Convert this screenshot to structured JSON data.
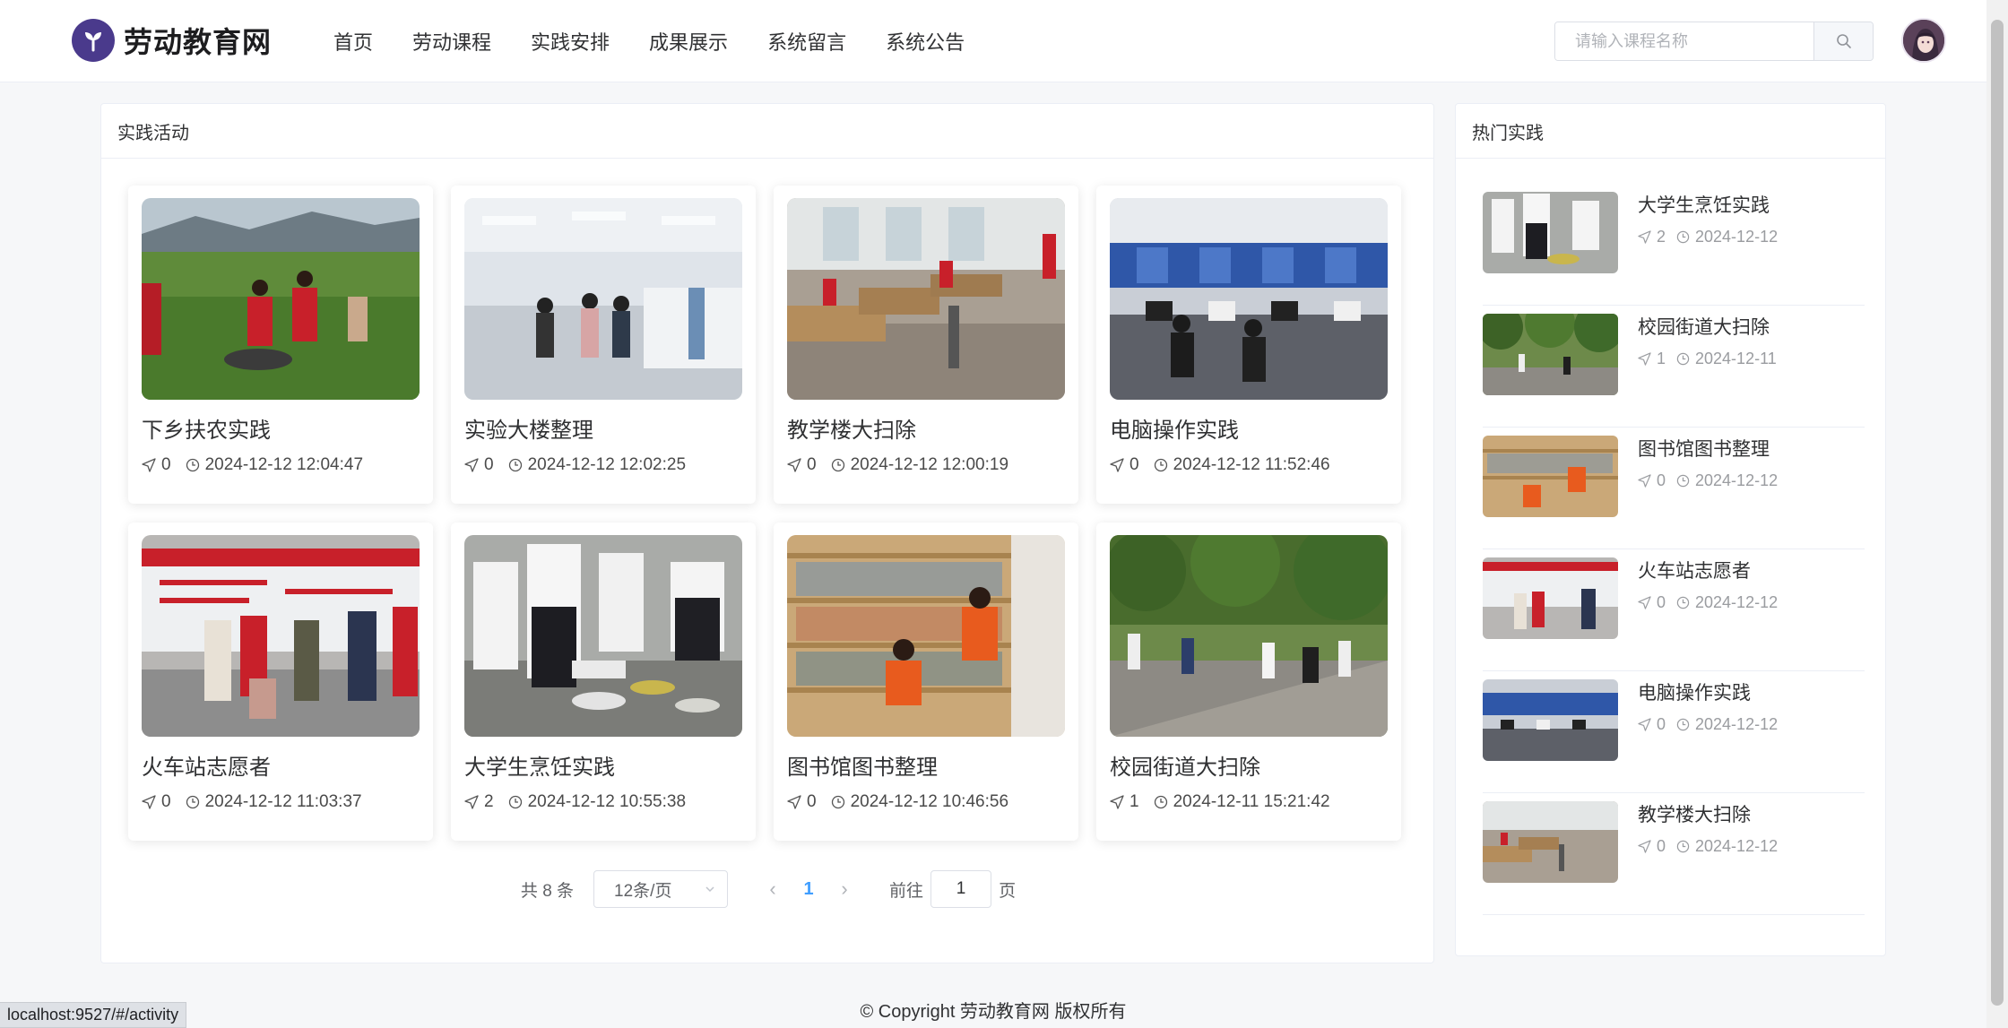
{
  "site": {
    "name": "劳动教育网",
    "brand_color": "#4a3a8c"
  },
  "nav": {
    "items": [
      "首页",
      "劳动课程",
      "实践安排",
      "成果展示",
      "系统留言",
      "系统公告"
    ]
  },
  "search": {
    "placeholder": "请输入课程名称",
    "icon": "search-icon"
  },
  "main": {
    "title": "实践活动",
    "cards": [
      {
        "title": "下乡扶农实践",
        "views": "0",
        "time": "2024-12-12 12:04:47"
      },
      {
        "title": "实验大楼整理",
        "views": "0",
        "time": "2024-12-12 12:02:25"
      },
      {
        "title": "教学楼大扫除",
        "views": "0",
        "time": "2024-12-12 12:00:19"
      },
      {
        "title": "电脑操作实践",
        "views": "0",
        "time": "2024-12-12 11:52:46"
      },
      {
        "title": "火车站志愿者",
        "views": "0",
        "time": "2024-12-12 11:03:37"
      },
      {
        "title": "大学生烹饪实践",
        "views": "2",
        "time": "2024-12-12 10:55:38"
      },
      {
        "title": "图书馆图书整理",
        "views": "0",
        "time": "2024-12-12 10:46:56"
      },
      {
        "title": "校园街道大扫除",
        "views": "1",
        "time": "2024-12-11 15:21:42"
      }
    ]
  },
  "pagination": {
    "total": "共 8 条",
    "page_size": "12条/页",
    "current": "1",
    "goto_prefix": "前往",
    "goto_value": "1",
    "goto_suffix": "页",
    "active_color": "#409eff"
  },
  "hot": {
    "title": "热门实践",
    "items": [
      {
        "title": "大学生烹饪实践",
        "views": "2",
        "date": "2024-12-12"
      },
      {
        "title": "校园街道大扫除",
        "views": "1",
        "date": "2024-12-11"
      },
      {
        "title": "图书馆图书整理",
        "views": "0",
        "date": "2024-12-12"
      },
      {
        "title": "火车站志愿者",
        "views": "0",
        "date": "2024-12-12"
      },
      {
        "title": "电脑操作实践",
        "views": "0",
        "date": "2024-12-12"
      },
      {
        "title": "教学楼大扫除",
        "views": "0",
        "date": "2024-12-12"
      }
    ]
  },
  "footer": {
    "copyright": "© Copyright 劳动教育网 版权所有"
  },
  "status_bar": {
    "url": "localhost:9527/#/activity"
  }
}
